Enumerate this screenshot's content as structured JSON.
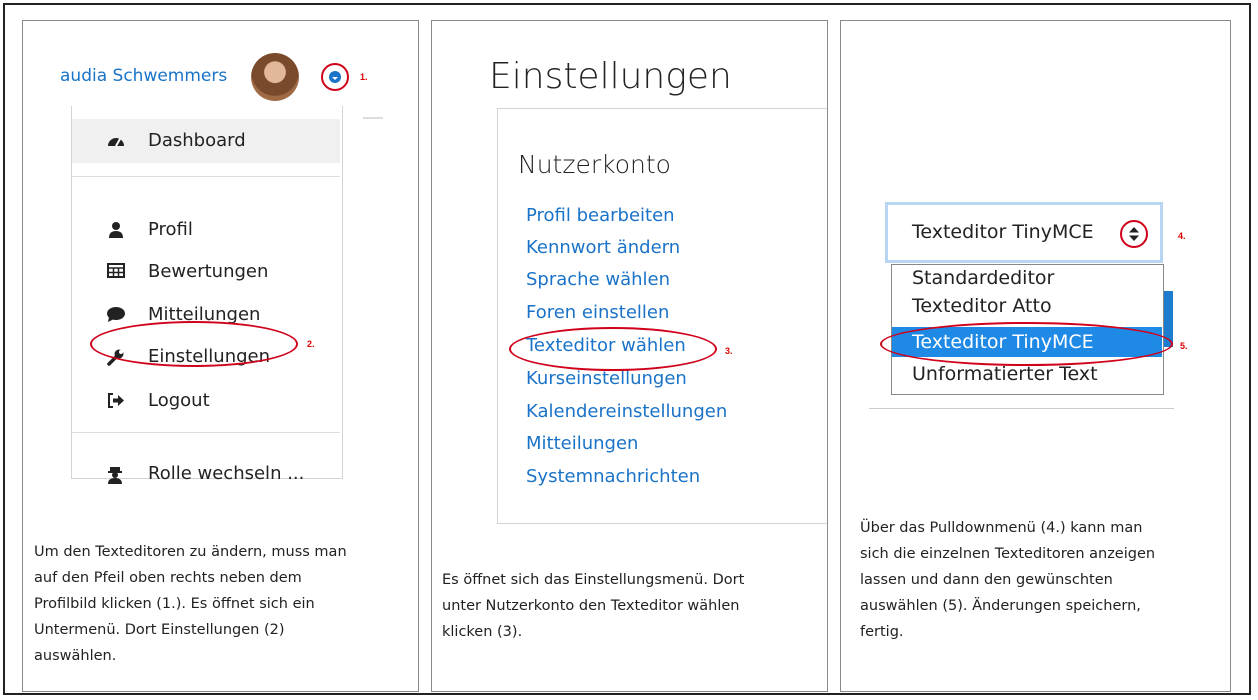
{
  "panel1": {
    "user_name": "audia Schwemmers",
    "marker_1": "1.",
    "marker_2": "2.",
    "menu": {
      "dashboard": "Dashboard",
      "profil": "Profil",
      "bewertungen": "Bewertungen",
      "mitteilungen": "Mitteilungen",
      "einstellungen": "Einstellungen",
      "logout": "Logout",
      "rolle": "Rolle wechseln ..."
    },
    "caption": [
      "Um den Texteditoren zu ändern, muss man",
      "auf den Pfeil oben rechts neben dem",
      "Profilbild klicken (1.). Es öffnet sich ein",
      "Untermenü. Dort Einstellungen (2)",
      "auswählen."
    ]
  },
  "panel2": {
    "title": "Einstellungen",
    "section": "Nutzerkonto",
    "marker_3": "3.",
    "links": {
      "profil_bearbeiten": "Profil bearbeiten",
      "kennwort": "Kennwort ändern",
      "sprache": "Sprache wählen",
      "foren": "Foren einstellen",
      "texteditor": "Texteditor wählen",
      "kurse": "Kurseinstellungen",
      "kalender": "Kalendereinstellungen",
      "mitteilungen": "Mitteilungen",
      "system": "Systemnachrichten"
    },
    "caption": [
      "Es öffnet sich das Einstellungsmenü. Dort",
      "unter Nutzerkonto den Texteditor wählen",
      "klicken (3)."
    ]
  },
  "panel3": {
    "select_value": "Texteditor TinyMCE",
    "marker_4": "4.",
    "marker_5": "5.",
    "options": {
      "standard": "Standardeditor",
      "atto": "Texteditor Atto",
      "tinymce": "Texteditor TinyMCE",
      "unformatted": "Unformatierter Text"
    },
    "caption": [
      "Über das Pulldownmenü (4.) kann man",
      "sich die einzelnen Texteditoren anzeigen",
      "lassen und dann den gewünschten",
      "auswählen (5). Änderungen speichern,",
      "fertig."
    ]
  },
  "colors": {
    "link_blue": "#1a73c8",
    "annotation_red": "#d0021b",
    "selected_bg": "#1e8ae6"
  }
}
